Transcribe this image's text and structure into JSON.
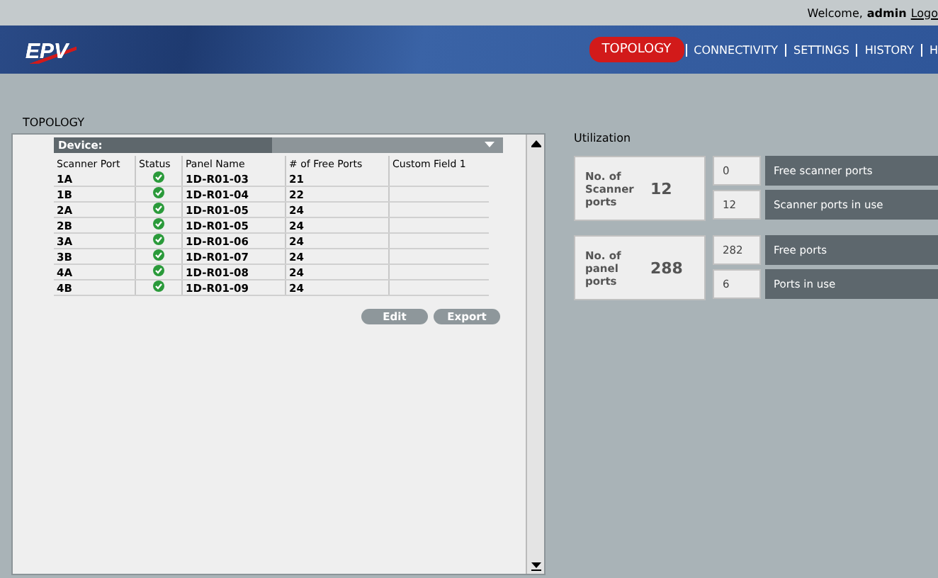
{
  "header": {
    "welcome": "Welcome,",
    "user": "admin",
    "logout": "Logo",
    "logo": "EPV",
    "nav": [
      {
        "label": "TOPOLOGY",
        "selected": true
      },
      {
        "label": "CONNECTIVITY",
        "selected": false
      },
      {
        "label": "SETTINGS",
        "selected": false
      },
      {
        "label": "HISTORY",
        "selected": false
      },
      {
        "label": "H",
        "selected": false
      }
    ]
  },
  "section_title": "TOPOLOGY",
  "device": {
    "label": "Device:"
  },
  "table": {
    "columns": [
      "Scanner Port",
      "Status",
      "Panel Name",
      "# of Free Ports",
      "Custom Field 1"
    ],
    "rows": [
      {
        "port": "1A",
        "ok": true,
        "panel": "1D-R01-03",
        "free": "21"
      },
      {
        "port": "1B",
        "ok": true,
        "panel": "1D-R01-04",
        "free": "22"
      },
      {
        "port": "2A",
        "ok": true,
        "panel": "1D-R01-05",
        "free": "24"
      },
      {
        "port": "2B",
        "ok": true,
        "panel": "1D-R01-05",
        "free": "24"
      },
      {
        "port": "3A",
        "ok": true,
        "panel": "1D-R01-06",
        "free": "24"
      },
      {
        "port": "3B",
        "ok": true,
        "panel": "1D-R01-07",
        "free": "24"
      },
      {
        "port": "4A",
        "ok": true,
        "panel": "1D-R01-08",
        "free": "24"
      },
      {
        "port": "4B",
        "ok": true,
        "panel": "1D-R01-09",
        "free": "24"
      }
    ]
  },
  "buttons": [
    "Edit",
    "Export"
  ],
  "utilization": {
    "title": "Utilization",
    "groups": [
      {
        "label": "No. of Scanner ports",
        "total": "12",
        "items": [
          {
            "value": "0",
            "label": "Free scanner ports"
          },
          {
            "value": "12",
            "label": "Scanner ports in use"
          }
        ]
      },
      {
        "label": "No. of panel ports",
        "total": "288",
        "items": [
          {
            "value": "282",
            "label": "Free ports"
          },
          {
            "value": "6",
            "label": "Ports in use"
          }
        ]
      }
    ]
  }
}
